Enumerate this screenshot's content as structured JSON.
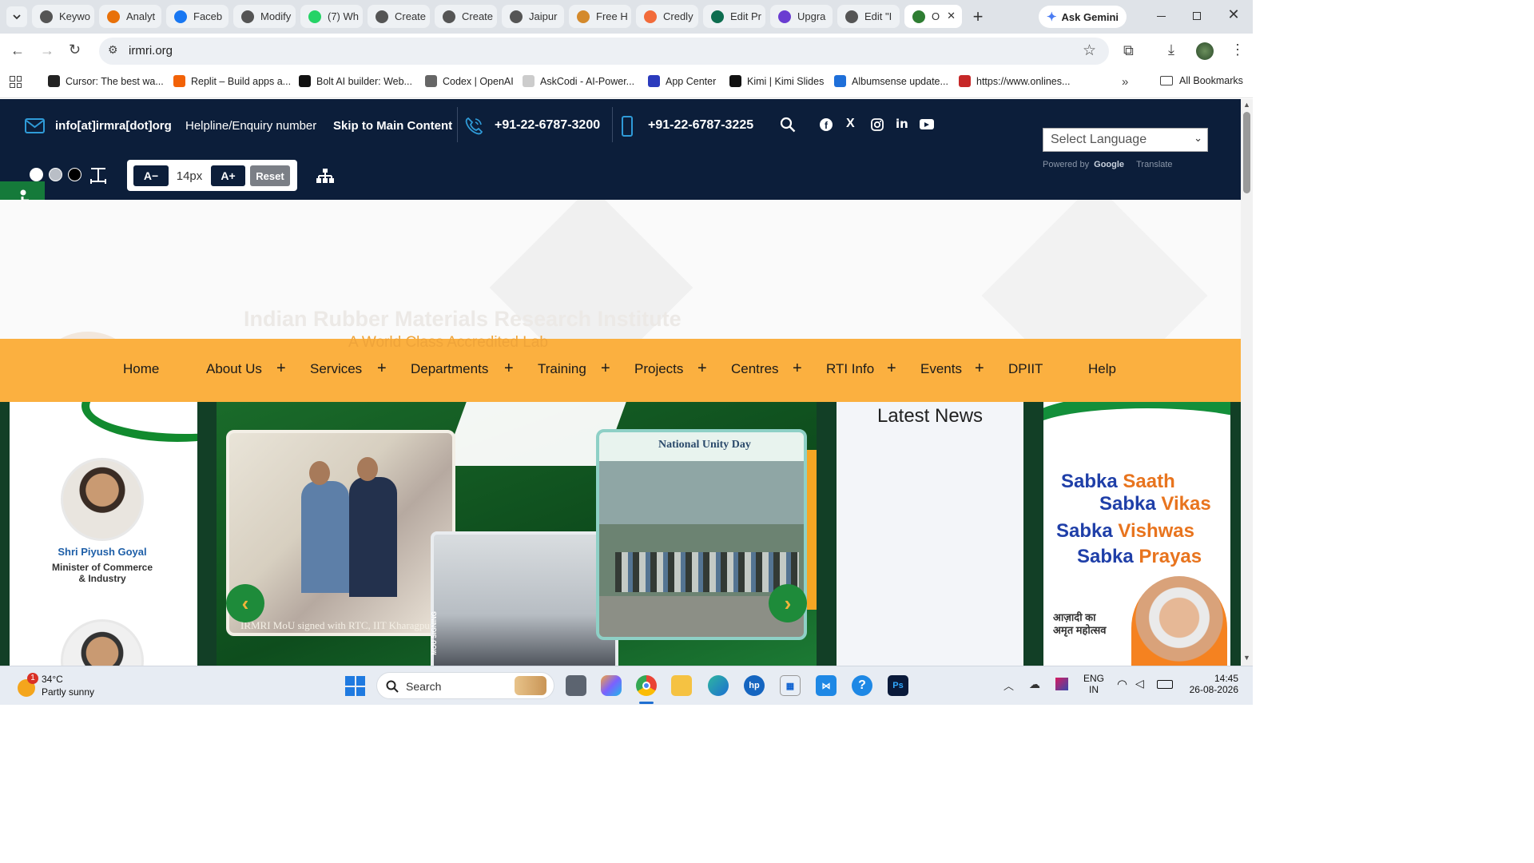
{
  "browser": {
    "tabs": [
      {
        "label": "Keywo",
        "icon": "chatgpt-icon",
        "color": "#555"
      },
      {
        "label": "Analyt",
        "icon": "analytics-icon",
        "color": "#e8710a"
      },
      {
        "label": "Faceb",
        "icon": "facebook-icon",
        "color": "#1877f2"
      },
      {
        "label": "Modify",
        "icon": "chatgpt-icon",
        "color": "#555"
      },
      {
        "label": "(7) Wh",
        "icon": "whatsapp-icon",
        "color": "#25d366"
      },
      {
        "label": "Create",
        "icon": "chatgpt-icon",
        "color": "#555"
      },
      {
        "label": "Create",
        "icon": "chatgpt-icon",
        "color": "#555"
      },
      {
        "label": "Jaipur",
        "icon": "chatgpt-icon",
        "color": "#555"
      },
      {
        "label": "Free H",
        "icon": "site-icon",
        "color": "#d48a2c"
      },
      {
        "label": "Credly",
        "icon": "credly-icon",
        "color": "#f26b3a"
      },
      {
        "label": "Edit Pr",
        "icon": "canva-icon",
        "color": "#0d6d4f"
      },
      {
        "label": "Upgra",
        "icon": "diamond-icon",
        "color": "#6a3dd1"
      },
      {
        "label": "Edit \"I",
        "icon": "chatgpt-icon",
        "color": "#555"
      },
      {
        "label": "O",
        "icon": "irmra-icon",
        "color": "#2e7d32"
      }
    ],
    "ask_gemini": "Ask Gemini",
    "url": "irmri.org",
    "bookmarks": [
      {
        "label": "Cursor: The best wa...",
        "color": "#222"
      },
      {
        "label": "Replit – Build apps a...",
        "color": "#f26207"
      },
      {
        "label": "Bolt AI builder: Web...",
        "color": "#111"
      },
      {
        "label": "Codex | OpenAI",
        "color": "#666"
      },
      {
        "label": "AskCodi - AI-Power...",
        "color": "#ccc"
      },
      {
        "label": "App Center",
        "color": "#2b3bbd"
      },
      {
        "label": "Kimi | Kimi Slides",
        "color": "#111"
      },
      {
        "label": "Albumsense update...",
        "color": "#1e6fd9"
      },
      {
        "label": "https://www.onlines...",
        "color": "#c62828"
      }
    ],
    "all_bookmarks": "All Bookmarks"
  },
  "site": {
    "email": "info[at]irmra[dot]org",
    "helpline": "Helpline/Enquiry number",
    "skip": "Skip to Main Content",
    "phone1": "+91-22-6787-3200",
    "phone2": "+91-22-6787-3225",
    "font_minus": "A−",
    "font_size": "14px",
    "font_plus": "A+",
    "font_reset": "Reset",
    "language_select": "Select Language",
    "powered_by": "Powered by",
    "google": "Google",
    "translate": "Translate",
    "banner_title": "Indian Rubber Materials Research Institute",
    "banner_subtitle": "A World Class Accredited Lab",
    "nav": [
      {
        "label": "Home",
        "plus": false
      },
      {
        "label": "About Us",
        "plus": true
      },
      {
        "label": "Services",
        "plus": true
      },
      {
        "label": "Departments",
        "plus": true
      },
      {
        "label": "Training",
        "plus": true
      },
      {
        "label": "Projects",
        "plus": true
      },
      {
        "label": "Centres",
        "plus": true
      },
      {
        "label": "RTI Info",
        "plus": true
      },
      {
        "label": "Events",
        "plus": true
      },
      {
        "label": "DPIIT",
        "plus": false
      },
      {
        "label": "Help",
        "plus": false
      }
    ],
    "minister_name": "Shri Piyush Goyal",
    "minister_title_1": "Minister of Commerce",
    "minister_title_2": "& Industry",
    "slide_left_caption": "IRMRI MoU signed with RTC, IIT Kharagpur",
    "slide_right_heading": "National Unity Day",
    "mou_side_label": "MOU SIGNING",
    "latest_news": "Latest News",
    "slogan": [
      "Sabka Saath",
      "Sabka Vikas",
      "Sabka Vishwas",
      "Sabka Prayas"
    ],
    "amrit": "आज़ादी का अमृत महोत्सव"
  },
  "taskbar": {
    "temperature": "34°C",
    "weather": "Partly sunny",
    "weather_badge": "1",
    "search_placeholder": "Search",
    "lang": "ENG",
    "region": "IN",
    "time": "14:45",
    "date": "26-08-2026"
  }
}
